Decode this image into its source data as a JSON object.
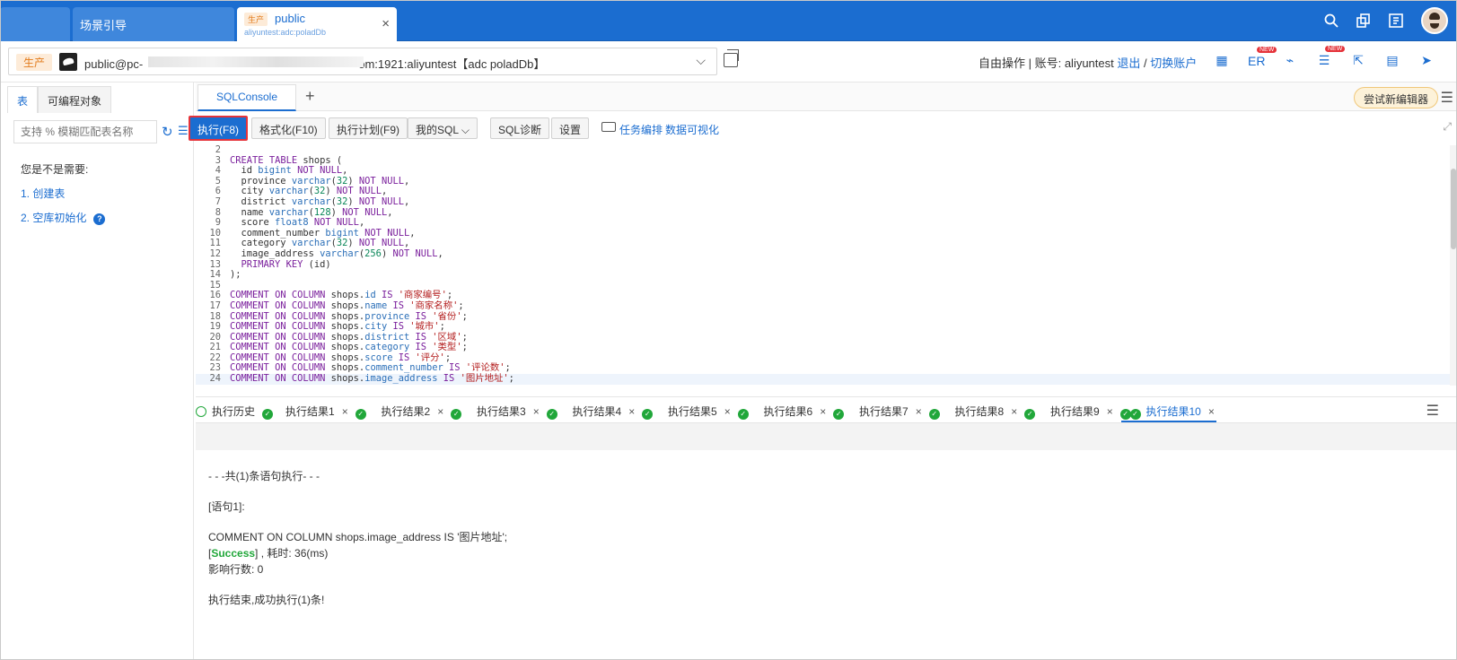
{
  "top_tabs": {
    "guide_label": "场景引导",
    "active": {
      "env": "生产",
      "name": "public",
      "sub": "aliyuntest:adc:poladDb",
      "close": "×"
    }
  },
  "conn": {
    "env": "生产",
    "text": "public@pc-",
    "suffix": "om:1921:aliyuntest【adc poladDb】",
    "chevron": "⌵"
  },
  "account": {
    "mode": "自由操作 | 账号: aliyuntest",
    "logout": "退出",
    "sep": "/",
    "switch": "切换账户"
  },
  "right_tools": {
    "er": "ER",
    "new1": "NEW",
    "new2": "NEW"
  },
  "left": {
    "tab_table": "表",
    "tab_prog": "可编程对象",
    "search_placeholder": "支持 % 模糊匹配表名称",
    "need_title": "您是不是需要:",
    "item1": "1.  创建表",
    "item2": "2.  空库初始化"
  },
  "editor": {
    "tab": "SQLConsole",
    "add": "+",
    "try_btn": "尝试新编辑器"
  },
  "toolbar": {
    "exec": "执行(F8)",
    "format": "格式化(F10)",
    "plan": "执行计划(F9)",
    "my_sql": "我的SQL  ⌵",
    "diag": "SQL诊断",
    "settings": "设置",
    "task": "任务编排",
    "visual": "数据可视化"
  },
  "code_lines": [
    {
      "n": "2",
      "t": ""
    },
    {
      "n": "3",
      "t": "CREATE TABLE shops ("
    },
    {
      "n": "4",
      "t": "  id bigint NOT NULL,"
    },
    {
      "n": "5",
      "t": "  province varchar(32) NOT NULL,"
    },
    {
      "n": "6",
      "t": "  city varchar(32) NOT NULL,"
    },
    {
      "n": "7",
      "t": "  district varchar(32) NOT NULL,"
    },
    {
      "n": "8",
      "t": "  name varchar(128) NOT NULL,"
    },
    {
      "n": "9",
      "t": "  score float8 NOT NULL,"
    },
    {
      "n": "10",
      "t": "  comment_number bigint NOT NULL,"
    },
    {
      "n": "11",
      "t": "  category varchar(32) NOT NULL,"
    },
    {
      "n": "12",
      "t": "  image_address varchar(256) NOT NULL,"
    },
    {
      "n": "13",
      "t": "  PRIMARY KEY (id)"
    },
    {
      "n": "14",
      "t": ");"
    },
    {
      "n": "15",
      "t": ""
    },
    {
      "n": "16",
      "t": "COMMENT ON COLUMN shops.id IS '商家编号';"
    },
    {
      "n": "17",
      "t": "COMMENT ON COLUMN shops.name IS '商家名称';"
    },
    {
      "n": "18",
      "t": "COMMENT ON COLUMN shops.province IS '省份';"
    },
    {
      "n": "19",
      "t": "COMMENT ON COLUMN shops.city IS '城市';"
    },
    {
      "n": "20",
      "t": "COMMENT ON COLUMN shops.district IS '区域';"
    },
    {
      "n": "21",
      "t": "COMMENT ON COLUMN shops.category IS '类型';"
    },
    {
      "n": "22",
      "t": "COMMENT ON COLUMN shops.score IS '评分';"
    },
    {
      "n": "23",
      "t": "COMMENT ON COLUMN shops.comment_number IS '评论数';"
    },
    {
      "n": "24",
      "t": "COMMENT ON COLUMN shops.image_address IS '图片地址';"
    }
  ],
  "result_tabs": {
    "history": "执行历史",
    "tabs": [
      "执行结果1",
      "执行结果2",
      "执行结果3",
      "执行结果4",
      "执行结果5",
      "执行结果6",
      "执行结果7",
      "执行结果8",
      "执行结果9",
      "执行结果10"
    ]
  },
  "result": {
    "l1": "- - -共(1)条语句执行- - -",
    "l2": "[语句1]:",
    "l3": "COMMENT ON COLUMN shops.image_address IS '图片地址';",
    "l4_pre": "[",
    "l4_success": "Success",
    "l4_post": "] ,  耗时: 36(ms)",
    "l5": "影响行数: 0",
    "l6": "执行结束,成功执行(1)条!"
  },
  "colors": {
    "brand": "#1b6dd0",
    "success": "#21a73a",
    "highlight_border": "#e5333a"
  }
}
